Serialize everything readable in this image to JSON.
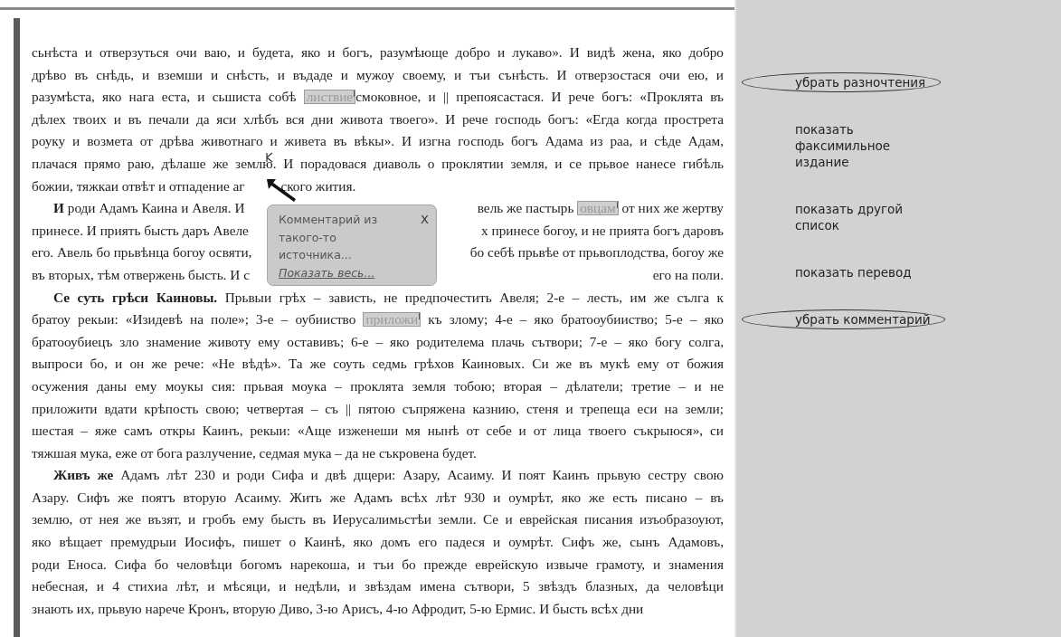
{
  "text": {
    "paragraphs": [
      {
        "indent": false,
        "lines": [
          {
            "segments": [
              {
                "kind": "text",
                "text": "сьнѣста и отверзуться очи ваю, и будета, яко и богъ, разумѣюще добро и лукаво». И видѣ жена, яко добро"
              }
            ]
          },
          {
            "segments": [
              {
                "kind": "text",
                "text": "дрѣво въ снѣдь, и вземши и снѣсть, и въдаде и мужоу своему, и тъи сънѣсть. И отверзостася очи ею, и"
              }
            ]
          },
          {
            "segments": [
              {
                "kind": "text",
                "text": "разумѣста, яко нага еста, и сьшиста собѣ "
              },
              {
                "kind": "variant",
                "text": "листвие"
              },
              {
                "kind": "text",
                "text": "смоковное, и || препоясастася. И рече богъ: «Проклята въ"
              }
            ]
          },
          {
            "segments": [
              {
                "kind": "text",
                "text": "дѣлех твоих и въ печали да яси хлѣбъ вся дни живота твоего». И рече господь богъ: «Егда когда прострета"
              }
            ]
          },
          {
            "segments": [
              {
                "kind": "text",
                "text": "роуку и возмета от дрѣва животнаго и живета въ вѣкы». И изгна господь богъ Адама из раа, и сѣде Адам,"
              }
            ]
          },
          {
            "segments": [
              {
                "kind": "text",
                "text": "плачася прямо раю, дѣлаше же землю. И порадовася диаволь о проклятии земля, и се прьвое нанесе гибѣль"
              }
            ]
          },
          {
            "segments": [
              {
                "kind": "text",
                "text": "божии, тяжкаи отвѣт и отпадение аг"
              },
              {
                "kind": "covered"
              },
              {
                "kind": "text",
                "text": "ского жития."
              }
            ]
          }
        ]
      },
      {
        "indent": true,
        "lines": [
          {
            "segments": [
              {
                "kind": "bold",
                "text": "И"
              },
              {
                "kind": "text",
                "text": " роди Адамъ Каина и Авеля. И"
              }
            ],
            "after_popup": [
              {
                "kind": "text",
                "text": "вель же пастырь "
              },
              {
                "kind": "variant",
                "text": "овцам"
              },
              {
                "kind": "text",
                "text": " от них же жертву"
              }
            ]
          },
          {
            "segments": [
              {
                "kind": "text",
                "text": "принесе. И приять бысть даръ Авеле"
              }
            ],
            "after_popup": [
              {
                "kind": "text",
                "text": "х принесе богоу, и не прията богъ даровъ"
              }
            ]
          },
          {
            "segments": [
              {
                "kind": "text",
                "text": "его. Авель бо прьвѣнца богоу освяти,"
              }
            ],
            "after_popup": [
              {
                "kind": "text",
                "text": "бо себѣ прьвѣе от прьвоплодства, богоу же"
              }
            ]
          },
          {
            "segments": [
              {
                "kind": "text",
                "text": "въ вторых, тѣм отвержень бысть. И с"
              }
            ],
            "after_popup": [
              {
                "kind": "text",
                "text": "его на поли."
              }
            ]
          }
        ]
      },
      {
        "indent": true,
        "lines": [
          {
            "segments": [
              {
                "kind": "bold",
                "text": "Се суть грѣси Каиновы."
              },
              {
                "kind": "text",
                "text": " Прьвыи грѣх – зависть, не предпочестить Авеля; 2-е – лесть, им же сълга к"
              }
            ]
          },
          {
            "segments": [
              {
                "kind": "text",
                "text": "братоу рекыи: «Изидевѣ на поле»; 3-е – оубииство "
              },
              {
                "kind": "variant",
                "text": "приложи"
              },
              {
                "kind": "text",
                "text": " къ злому; 4-е – яко братооубииство; 5-е – яко"
              }
            ]
          },
          {
            "segments": [
              {
                "kind": "text",
                "text": "братооубиецъ зло знамение животу ему оставивъ; 6-е – яко родителема плачь сътвори; 7-е – яко богу солга,"
              }
            ]
          },
          {
            "segments": [
              {
                "kind": "text",
                "text": "выпроси бо, и он же рече: «Не вѣдѣ». Та же соуть седмь грѣхов Каиновых. Си же въ мукѣ ему от божия"
              }
            ]
          },
          {
            "segments": [
              {
                "kind": "text",
                "text": "осужения даны ему моукы сия: прьвая моука – проклята земля тобою; вторая – дѣлатели; третие – и не"
              }
            ]
          },
          {
            "segments": [
              {
                "kind": "text",
                "text": "приложити вдати крѣпость свою; четвертая – съ || пятою съпряжена казнию, стеня и трепеща еси на земли;"
              }
            ]
          },
          {
            "segments": [
              {
                "kind": "text",
                "text": "шестая – яже самъ откры Каинъ, рекыи: «Аще изженеши мя нынѣ от себе и от лица твоего съкрыюся», си"
              }
            ]
          },
          {
            "segments": [
              {
                "kind": "text",
                "text": "тяжшая мука, еже от бога разлучение, седмая мука – да не съкровена будет."
              }
            ]
          }
        ]
      },
      {
        "indent": true,
        "lines": [
          {
            "segments": [
              {
                "kind": "bold",
                "text": "Живъ же"
              },
              {
                "kind": "text",
                "text": " Адамъ лѣт 230 и роди Сифа и двѣ дщери: Азару, Асаиму. И поят Каинъ прьвую сестру свою"
              }
            ]
          },
          {
            "segments": [
              {
                "kind": "text",
                "text": "Азару. Сифъ же поятъ вторую Асаиму. Жить же Адамъ всѣх лѣт 930 и оумрѣт, яко же есть писано – въ"
              }
            ]
          },
          {
            "segments": [
              {
                "kind": "text",
                "text": "землю, от нея же възят, и гробъ ему бысть въ Иерусалимьстѣи земли. Се и еврейская писания изъобразоуют,"
              }
            ]
          },
          {
            "segments": [
              {
                "kind": "text",
                "text": "яко вѣщает премудрыи Иосифъ, пишет о Каинѣ, яко домъ его падеся и оумрѣт. Сифъ же, сынъ Адамовъ,"
              }
            ]
          },
          {
            "segments": [
              {
                "kind": "text",
                "text": "роди Еноса. Сифа бо человѣци богомъ нарекоша, и тъи бо прежде еврейскую извыче грамоту, и знамения"
              }
            ]
          },
          {
            "segments": [
              {
                "kind": "text",
                "text": "небесная, и 4 стихиа лѣт, и мѣсяци, и недѣли, и звѣздам имена сътвори, 5 звѣздъ блазных, да человѣци"
              }
            ]
          },
          {
            "segments": [
              {
                "kind": "text",
                "text": "знають их, прьвую нарече Кронъ, вторую Диво, 3-ю Арисъ, 4-ю Афродит, 5-ю Ермис. И бысть всѣх дни"
              }
            ]
          }
        ]
      }
    ]
  },
  "popup": {
    "lines": [
      "Комментарий из",
      "такого-то",
      "источника..."
    ],
    "close": "X",
    "link": "Показать весь..."
  },
  "sidebar": {
    "items": [
      {
        "label": "убрать разночтения",
        "circled": true
      },
      {
        "label": "показать факсимильное издание",
        "circled": false
      },
      {
        "label": "показать другой список",
        "circled": false
      },
      {
        "label": "показать перевод",
        "circled": false
      },
      {
        "label": "убрать комментарий",
        "circled": true
      }
    ]
  }
}
